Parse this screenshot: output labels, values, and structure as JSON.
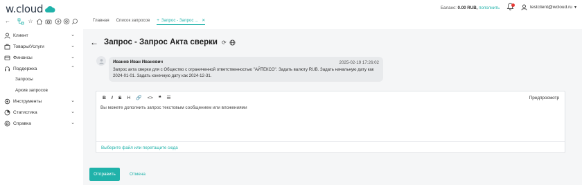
{
  "brand": {
    "logo_text": "w.cloud",
    "accent": "#20b2aa"
  },
  "header": {
    "balance_label": "Баланс:",
    "balance_value": "0.00 RUB,",
    "topup_label": "пополнить",
    "user_name": "testclient@wcloud.ru"
  },
  "toolbar_icons": [
    "back-icon",
    "tree-icon",
    "star-icon",
    "home-icon",
    "camera-icon",
    "add-circle-icon",
    "settings-icon",
    "search-icon"
  ],
  "tabs": [
    {
      "label": "Главная"
    },
    {
      "label": "Список запросов"
    },
    {
      "label": "Запрос - Запрос ...",
      "active": true
    }
  ],
  "sidebar": {
    "items": [
      {
        "label": "Клиент"
      },
      {
        "label": "Товары/Услуги"
      },
      {
        "label": "Финансы"
      },
      {
        "label": "Поддержка"
      },
      {
        "label": "Инструменты"
      },
      {
        "label": "Статистика"
      },
      {
        "label": "Справка"
      }
    ],
    "sub_items": [
      {
        "label": "Запросы"
      },
      {
        "label": "Архив запросов"
      }
    ]
  },
  "page": {
    "title": "Запрос - Запрос Акта сверки"
  },
  "message": {
    "author": "Иванов Иван Иванович",
    "timestamp": "2025-02-19 17:26:02",
    "line1": "Запрос акта сверки для  с Общество с ограниченной ответственностью \"АЙТЕКСО\". Задать валюту RUB. Задать начальную дату как",
    "line2": "2024-01-01. Задать конечную дату как 2024-12-31."
  },
  "editor": {
    "toolbar": [
      "B",
      "I",
      "S",
      "H",
      "🔗",
      "<>",
      "❝",
      "☰"
    ],
    "preview_label": "Предпросмотр",
    "placeholder": "Вы можете дополнить запрос текстовым сообщением или вложениями",
    "attach_label": "Выберите файл или перетащите сюда"
  },
  "actions": {
    "send_label": "Отправить",
    "cancel_label": "Отмена"
  }
}
